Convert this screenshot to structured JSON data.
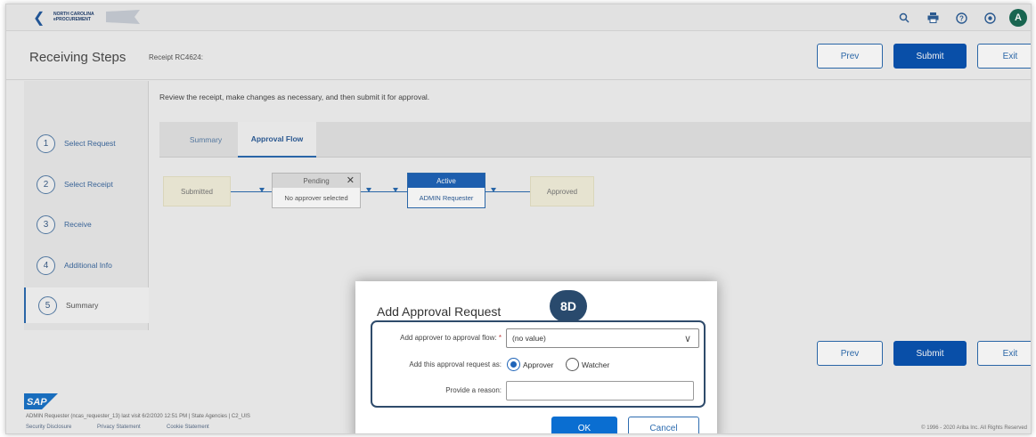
{
  "topbar": {
    "logo_line1": "NORTH CAROLINA",
    "logo_line2": "ePROCUREMENT",
    "avatar_initial": "A",
    "icons": [
      "back-arrow-icon",
      "search-icon",
      "printer-icon",
      "help-icon",
      "settings-icon"
    ]
  },
  "header": {
    "title": "Receiving Steps",
    "receipt_id": "Receipt RC4624:",
    "prev_label": "Prev",
    "submit_label": "Submit",
    "exit_label": "Exit"
  },
  "steps": [
    {
      "num": "1",
      "label": "Select Request"
    },
    {
      "num": "2",
      "label": "Select Receipt"
    },
    {
      "num": "3",
      "label": "Receive"
    },
    {
      "num": "4",
      "label": "Additional Info"
    },
    {
      "num": "5",
      "label": "Summary"
    }
  ],
  "content": {
    "instructions": "Review the receipt, make changes as necessary, and then submit it for approval.",
    "tabs": [
      "Summary",
      "Approval Flow"
    ]
  },
  "flow": {
    "submitted": "Submitted",
    "pending_header": "Pending",
    "pending_body": "No approver selected",
    "active_header": "Active",
    "active_body": "ADMIN Requester",
    "approved": "Approved"
  },
  "modal": {
    "title": "Add Approval Request",
    "badge": "8D",
    "approver_flow_label": "Add approver to approval flow:",
    "required_mark": "*",
    "select_value": "(no value)",
    "add_as_label": "Add this approval request as:",
    "radio_approver": "Approver",
    "radio_watcher": "Watcher",
    "reason_label": "Provide a reason:",
    "ok_label": "OK",
    "cancel_label": "Cancel"
  },
  "bottom_buttons": {
    "prev_label": "Prev",
    "submit_label": "Submit",
    "exit_label": "Exit"
  },
  "footer": {
    "sap_logo": "SAP",
    "user_line": "ADMIN Requester (ncas_requester_13) last visit 6/2/2020 12:51 PM | State Agencies | C2_UIS",
    "security_link": "Security Disclosure",
    "privacy_link": "Privacy Statement",
    "cookie_link": "Cookie Statement",
    "copyright": "© 1996 - 2020 Ariba Inc. All Rights Reserved"
  },
  "colors": {
    "primary": "#0a54b2",
    "badge": "#294a6d",
    "active_step": "#2d6cb0"
  }
}
